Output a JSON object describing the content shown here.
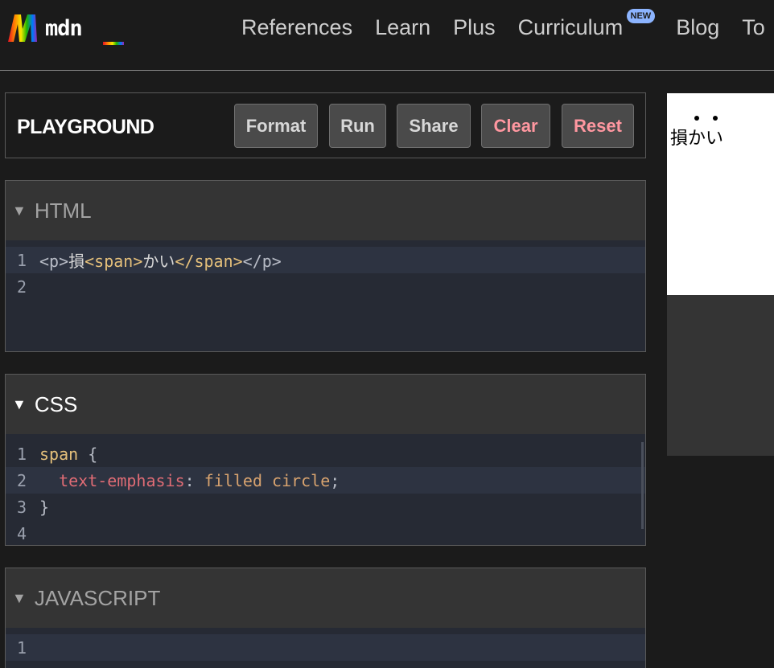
{
  "header": {
    "logo_text": "mdn",
    "nav": [
      {
        "label": "References"
      },
      {
        "label": "Learn"
      },
      {
        "label": "Plus"
      },
      {
        "label": "Curriculum",
        "badge": "NEW"
      },
      {
        "label": "Blog"
      },
      {
        "label": "To"
      }
    ]
  },
  "playground": {
    "title": "PLAYGROUND",
    "buttons": {
      "format": "Format",
      "run": "Run",
      "share": "Share",
      "clear": "Clear",
      "reset": "Reset"
    }
  },
  "panels": {
    "html": {
      "title": "HTML",
      "line_numbers": [
        "1",
        "2"
      ],
      "code": {
        "open_p": "<p>",
        "text_a": "損",
        "open_span": "<span>",
        "text_b": "かい",
        "close_span": "</span>",
        "close_p": "</p>"
      }
    },
    "css": {
      "title": "CSS",
      "line_numbers": [
        "1",
        "2",
        "3",
        "4"
      ],
      "code": {
        "selector": "span",
        "open_brace": " {",
        "property": "text-emphasis",
        "colon": ": ",
        "value": "filled circle",
        "semicolon": ";",
        "close_brace": "}"
      }
    },
    "javascript": {
      "title": "JAVASCRIPT",
      "line_numbers": [
        "1"
      ]
    }
  },
  "preview": {
    "text_plain": "損",
    "text_emphasized": "かい"
  },
  "colors": {
    "background": "#1b1b1b",
    "editor_bg": "#262a34",
    "panel_header": "#343434",
    "danger_text": "#ff97a0",
    "tag": "#e5c07b",
    "property": "#e06c75",
    "value": "#d8a36f",
    "badge": "#8cb4ff"
  },
  "icons": {
    "logo": "mdn-rainbow-m-logo",
    "panel_toggle": "caret-down-icon"
  }
}
